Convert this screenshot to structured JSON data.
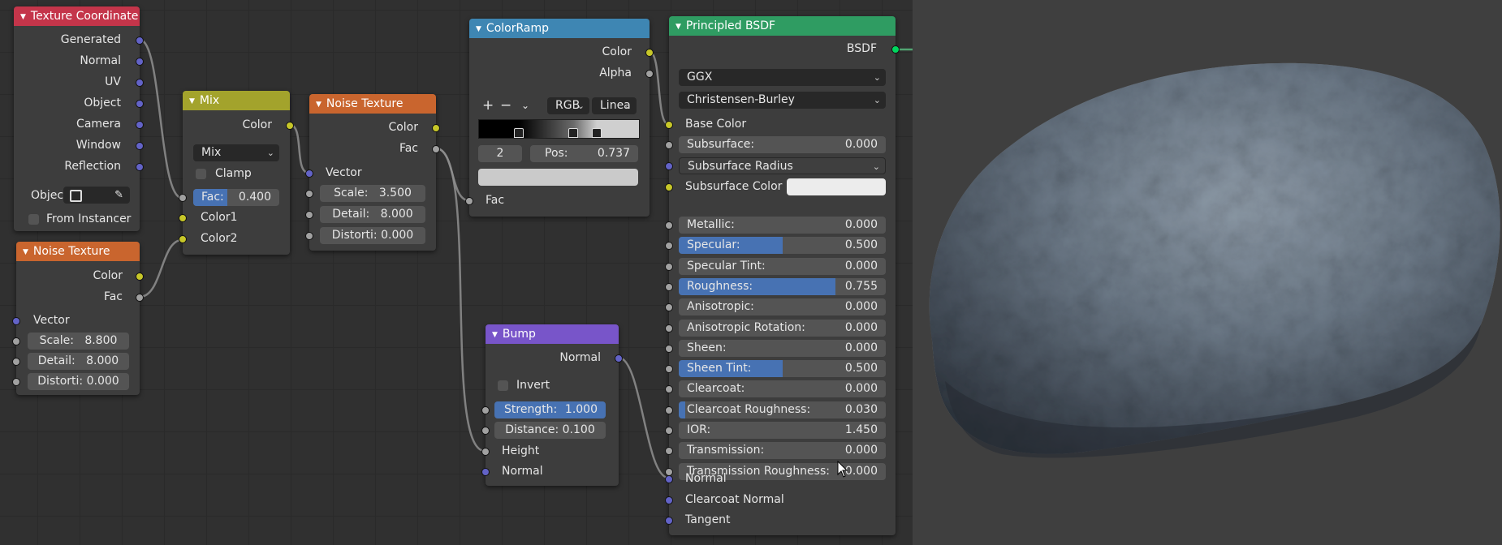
{
  "nodes": {
    "texcoord": {
      "title": "Texture Coordinate",
      "outputs": [
        "Generated",
        "Normal",
        "UV",
        "Object",
        "Camera",
        "Window",
        "Reflection"
      ],
      "object_label": "Objec",
      "from_instancer": "From Instancer"
    },
    "noise1": {
      "title": "Noise Texture",
      "outputs": [
        "Color",
        "Fac"
      ],
      "vector": "Vector",
      "scale_label": "Scale:",
      "scale_value": "8.800",
      "detail_label": "Detail:",
      "detail_value": "8.000",
      "distortion_label": "Distorti:",
      "distortion_value": "0.000"
    },
    "mix": {
      "title": "Mix",
      "output": "Color",
      "blend_mode": "Mix",
      "clamp": "Clamp",
      "fac_label": "Fac:",
      "fac_value": "0.400",
      "fac_fraction": 0.4,
      "color1": "Color1",
      "color2": "Color2"
    },
    "noise2": {
      "title": "Noise Texture",
      "outputs": [
        "Color",
        "Fac"
      ],
      "vector": "Vector",
      "scale_label": "Scale:",
      "scale_value": "3.500",
      "detail_label": "Detail:",
      "detail_value": "8.000",
      "distortion_label": "Distorti:",
      "distortion_value": "0.000"
    },
    "colorramp": {
      "title": "ColorRamp",
      "outputs": [
        "Color",
        "Alpha"
      ],
      "add": "+",
      "remove": "−",
      "color_mode": "RGB",
      "interpolation": "Linea",
      "stop_index": "2",
      "pos_label": "Pos:",
      "pos_value": "0.737",
      "input": "Fac",
      "stops": [
        0.25,
        0.59,
        0.737
      ]
    },
    "bump": {
      "title": "Bump",
      "output": "Normal",
      "invert": "Invert",
      "strength_label": "Strength:",
      "strength_value": "1.000",
      "distance_label": "Distance:",
      "distance_value": "0.100",
      "height": "Height",
      "normal": "Normal"
    },
    "bsdf": {
      "title": "Principled BSDF",
      "output": "BSDF",
      "distribution": "GGX",
      "subsurface_method": "Christensen-Burley",
      "base_color": "Base Color",
      "subsurface": {
        "label": "Subsurface:",
        "value": "0.000",
        "fraction": 0
      },
      "subsurface_radius": "Subsurface Radius",
      "subsurface_color": "Subsurface Color",
      "params": [
        {
          "label": "Metallic:",
          "value": "0.000",
          "fraction": 0
        },
        {
          "label": "Specular:",
          "value": "0.500",
          "fraction": 0.5
        },
        {
          "label": "Specular Tint:",
          "value": "0.000",
          "fraction": 0
        },
        {
          "label": "Roughness:",
          "value": "0.755",
          "fraction": 0.755
        },
        {
          "label": "Anisotropic:",
          "value": "0.000",
          "fraction": 0
        },
        {
          "label": "Anisotropic Rotation:",
          "value": "0.000",
          "fraction": 0
        },
        {
          "label": "Sheen:",
          "value": "0.000",
          "fraction": 0
        },
        {
          "label": "Sheen Tint:",
          "value": "0.500",
          "fraction": 0.5
        },
        {
          "label": "Clearcoat:",
          "value": "0.000",
          "fraction": 0
        },
        {
          "label": "Clearcoat Roughness:",
          "value": "0.030",
          "fraction": 0.03
        },
        {
          "label": "IOR:",
          "value": "1.450",
          "fraction": 0
        },
        {
          "label": "Transmission:",
          "value": "0.000",
          "fraction": 0
        },
        {
          "label": "Transmission Roughness:",
          "value": "0.000",
          "fraction": 0
        }
      ],
      "normal": "Normal",
      "clearcoat_normal": "Clearcoat Normal",
      "tangent": "Tangent"
    }
  },
  "colors": {
    "texcoord_header": "#c4354a",
    "noise_header": "#c9652e",
    "mix_header": "#a3a32c",
    "colorramp_header": "#3e86b3",
    "bump_header": "#7855c9",
    "bsdf_header": "#2f9c62",
    "socket_color": "#c7c729",
    "socket_float": "#a1a1a1",
    "socket_vector": "#6363c7",
    "socket_shader": "#00d65e",
    "slider_fill": "#4772b3"
  }
}
